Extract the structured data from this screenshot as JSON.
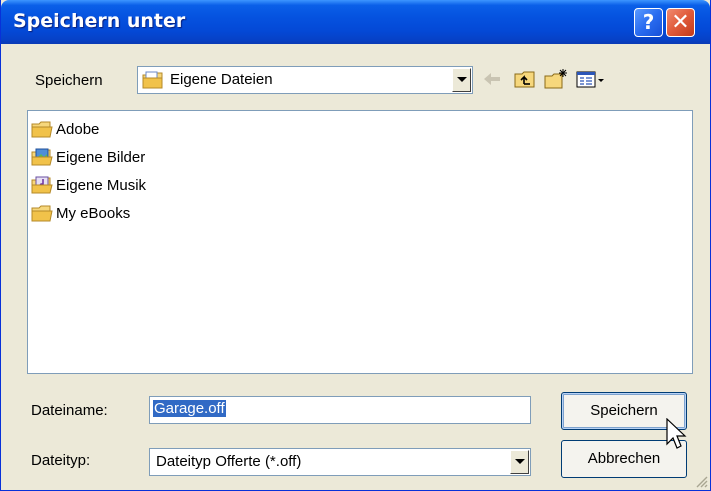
{
  "window": {
    "title": "Speichern unter",
    "help_button": "?",
    "close_button": "✕"
  },
  "location": {
    "label": "Speichern",
    "value": "Eigene Dateien"
  },
  "files": [
    {
      "name": "Adobe",
      "icon": "folder-icon"
    },
    {
      "name": "Eigene Bilder",
      "icon": "pictures-folder-icon"
    },
    {
      "name": "Eigene Musik",
      "icon": "music-folder-icon"
    },
    {
      "name": "My eBooks",
      "icon": "folder-icon"
    }
  ],
  "filename": {
    "label": "Dateiname:",
    "value": "Garage.off"
  },
  "filetype": {
    "label": "Dateityp:",
    "value": "Dateityp Offerte (*.off)"
  },
  "buttons": {
    "save": "Speichern",
    "cancel": "Abbrechen"
  },
  "colors": {
    "titlebar": "#0552df",
    "selection": "#316ac5",
    "dialog_bg": "#ece9d8"
  }
}
